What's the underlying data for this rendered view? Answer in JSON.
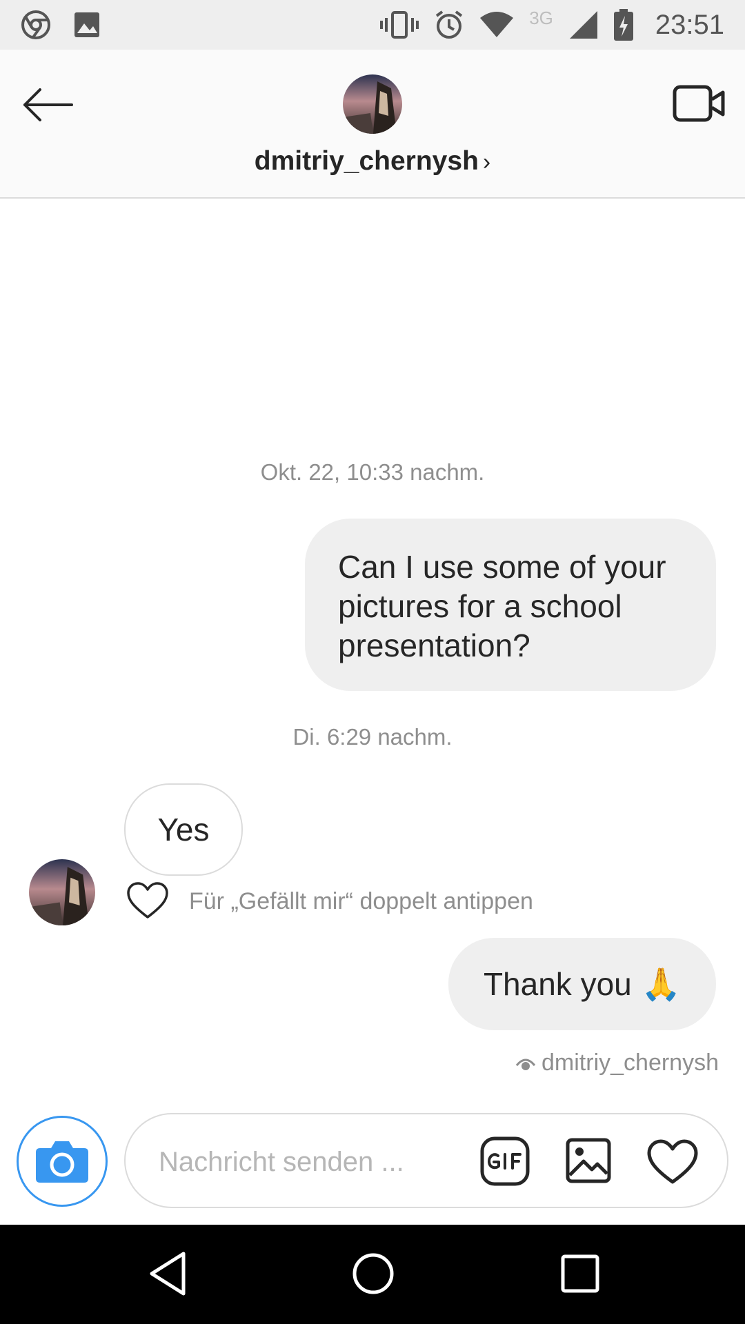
{
  "status_bar": {
    "time": "23:51",
    "network_type": "3G",
    "icons": [
      "chrome-icon",
      "image-icon",
      "vibrate-icon",
      "alarm-icon",
      "wifi-icon",
      "signal-icon",
      "battery-icon"
    ]
  },
  "header": {
    "username": "dmitriy_chernysh",
    "chevron": "›"
  },
  "conversation": {
    "timestamp_1": "Okt. 22, 10:33 nachm.",
    "message_1": "Can I use some of your pictures for a school presentation?",
    "timestamp_2": "Di. 6:29 nachm.",
    "message_2": "Yes",
    "like_hint": "Für „Gefällt mir“ doppelt antippen",
    "message_3_text": "Thank you",
    "message_3_emoji": "🙏",
    "seen_by": "dmitriy_chernysh"
  },
  "composer": {
    "placeholder": "Nachricht senden ..."
  },
  "colors": {
    "accent": "#3897f0",
    "bubble_out": "#efefef",
    "muted_text": "#8e8e8e"
  }
}
